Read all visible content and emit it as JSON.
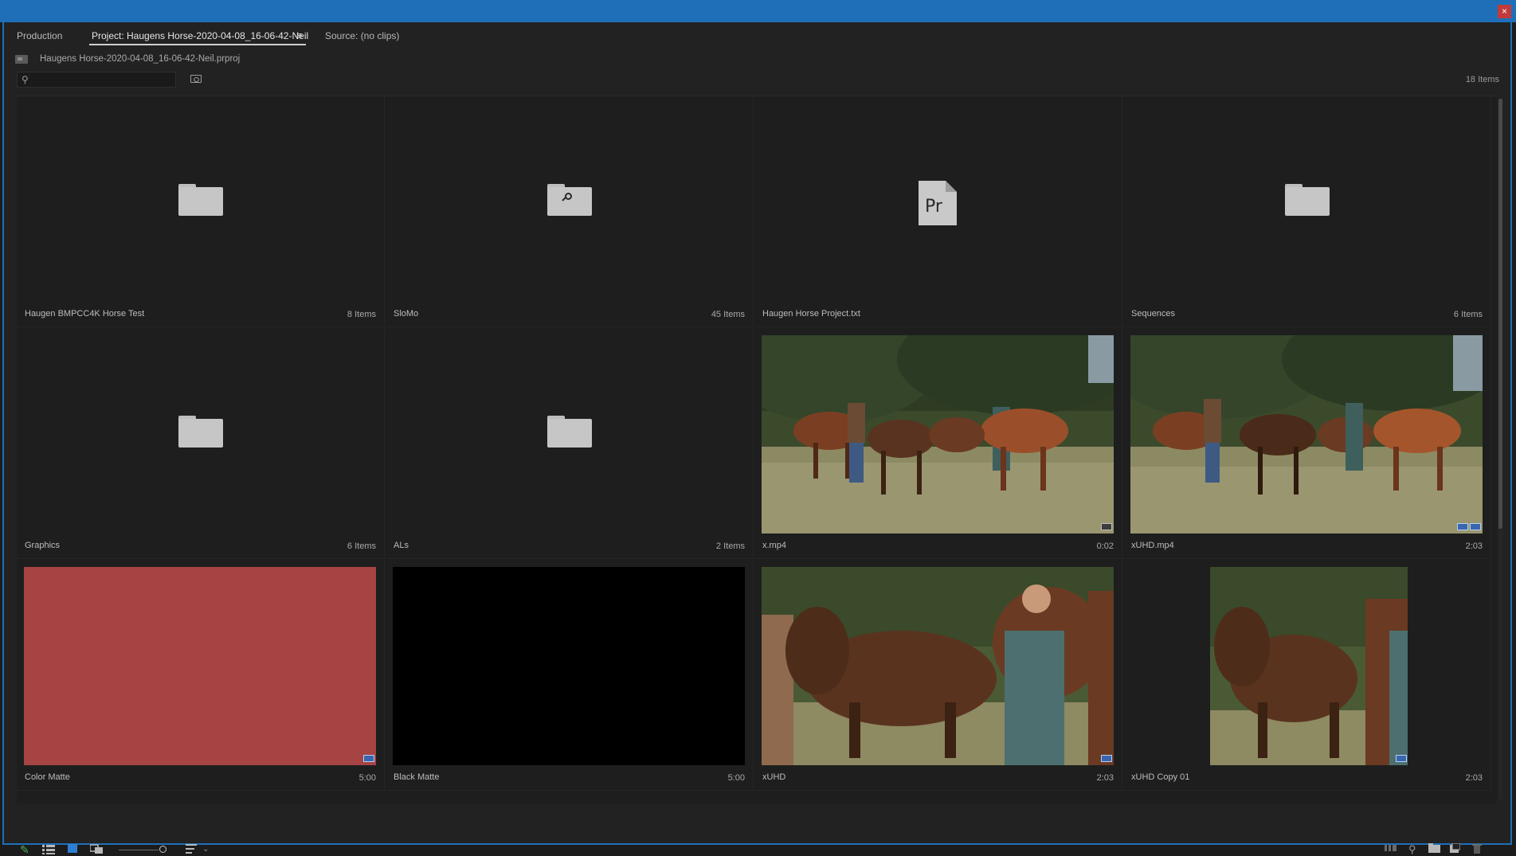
{
  "window": {
    "close_label": "×"
  },
  "tabs": [
    {
      "label": "Production"
    },
    {
      "label": "Project: Haugens Horse-2020-04-08_16-06-42-Neil"
    },
    {
      "label": "Source: (no clips)"
    }
  ],
  "tab_menu_glyph": "≡",
  "project": {
    "file_name": "Haugens Horse-2020-04-08_16-06-42-Neil.prproj",
    "items_count": "18 Items"
  },
  "search": {
    "value": "",
    "placeholder": ""
  },
  "items": [
    {
      "name": "Haugen BMPCC4K Horse Test",
      "meta": "8 Items",
      "kind": "folder"
    },
    {
      "name": "SloMo",
      "meta": "45 Items",
      "kind": "search-bin"
    },
    {
      "name": "Haugen Horse Project.txt",
      "meta": "",
      "kind": "premiere-file",
      "file_badge": "Pr"
    },
    {
      "name": "Sequences",
      "meta": "6 Items",
      "kind": "folder"
    },
    {
      "name": "Graphics",
      "meta": "6 Items",
      "kind": "folder"
    },
    {
      "name": "ALs",
      "meta": "2 Items",
      "kind": "folder"
    },
    {
      "name": "x.mp4",
      "meta": "0:02",
      "kind": "clip"
    },
    {
      "name": "xUHD.mp4",
      "meta": "2:03",
      "kind": "clip"
    },
    {
      "name": "Color Matte",
      "meta": "5:00",
      "kind": "matte",
      "color": "#a64343"
    },
    {
      "name": "Black Matte",
      "meta": "5:00",
      "kind": "matte",
      "color": "#000000"
    },
    {
      "name": "xUHD",
      "meta": "2:03",
      "kind": "sequence"
    },
    {
      "name": "xUHD Copy 01",
      "meta": "2:03",
      "kind": "sequence"
    }
  ],
  "colors": {
    "accent": "#1f6fb8",
    "panel": "#222222",
    "label_green": "#4caf50"
  }
}
